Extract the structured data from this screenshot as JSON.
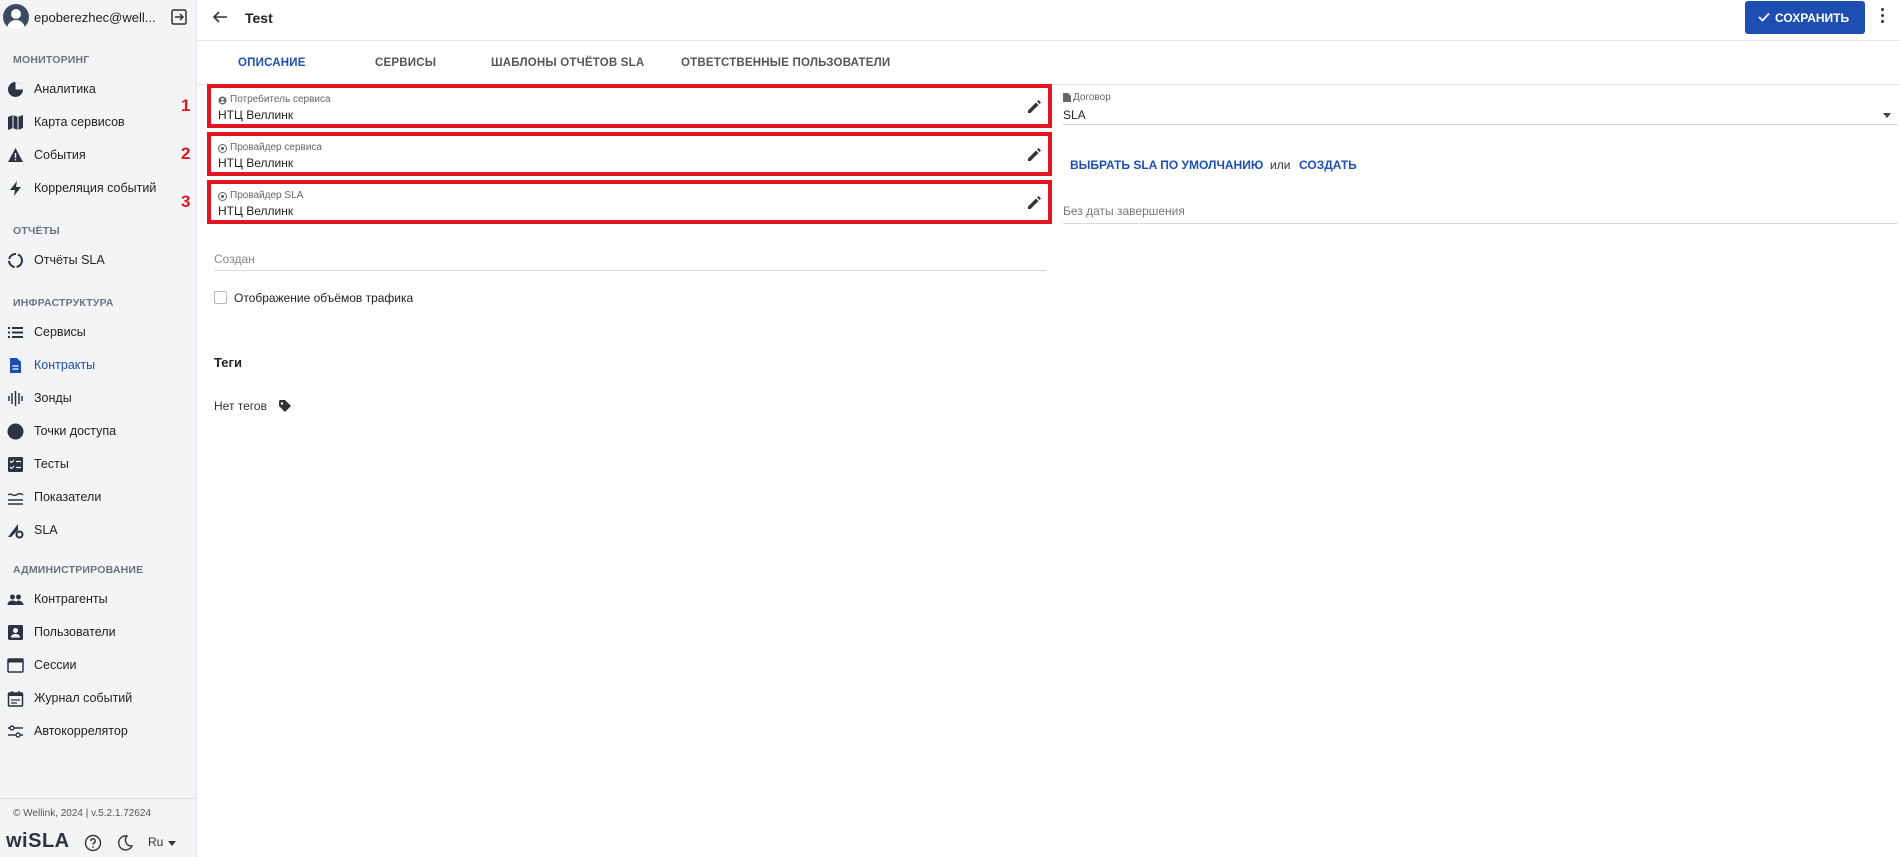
{
  "user": {
    "name": "epoberezhec@well..."
  },
  "sidebar": {
    "sections": [
      {
        "title": "МОНИТОРИНГ",
        "items": [
          {
            "label": "Аналитика",
            "icon": "pie-chart-icon"
          },
          {
            "label": "Карта сервисов",
            "icon": "map-icon"
          },
          {
            "label": "События",
            "icon": "warning-icon"
          },
          {
            "label": "Корреляция событий",
            "icon": "lightning-icon"
          }
        ]
      },
      {
        "title": "ОТЧЁТЫ",
        "items": [
          {
            "label": "Отчёты SLA",
            "icon": "circle-progress-icon"
          }
        ]
      },
      {
        "title": "ИНФРАСТРУКТУРА",
        "items": [
          {
            "label": "Сервисы",
            "icon": "list-icon"
          },
          {
            "label": "Контракты",
            "icon": "document-icon",
            "active": true
          },
          {
            "label": "Зонды",
            "icon": "waveform-icon"
          },
          {
            "label": "Точки доступа",
            "icon": "dot-icon"
          },
          {
            "label": "Тесты",
            "icon": "checklist-icon"
          },
          {
            "label": "Показатели",
            "icon": "lines-icon"
          },
          {
            "label": "SLA",
            "icon": "sla-gear-icon"
          }
        ]
      },
      {
        "title": "АДМИНИСТРИРОВАНИЕ",
        "items": [
          {
            "label": "Контрагенты",
            "icon": "people-icon"
          },
          {
            "label": "Пользователи",
            "icon": "user-card-icon"
          },
          {
            "label": "Сессии",
            "icon": "window-icon"
          },
          {
            "label": "Журнал событий",
            "icon": "calendar-icon"
          },
          {
            "label": "Автокоррелятор",
            "icon": "sliders-icon"
          }
        ]
      }
    ],
    "footer": {
      "copyright": "© Wellink, 2024 | v.5.2.1.72624",
      "logo": "wiSLA",
      "language": "Ru"
    }
  },
  "header": {
    "title": "Test",
    "save_label": "СОХРАНИТЬ"
  },
  "tabs": [
    {
      "label": "ОПИСАНИЕ",
      "active": true
    },
    {
      "label": "СЕРВИСЫ"
    },
    {
      "label": "ШАБЛОНЫ ОТЧЁТОВ SLA"
    },
    {
      "label": "ОТВЕТСТВЕННЫЕ ПОЛЬЗОВАТЕЛИ"
    }
  ],
  "fields": [
    {
      "number": "1",
      "label": "Потребитель сервиса",
      "value": "НТЦ Веллинк"
    },
    {
      "number": "2",
      "label": "Провайдер сервиса",
      "value": "НТЦ Веллинк"
    },
    {
      "number": "3",
      "label": "Провайдер SLA",
      "value": "НТЦ Веллинк"
    }
  ],
  "contract": {
    "label": "Договор",
    "value": "SLA"
  },
  "sla_actions": {
    "default_label": "ВЫБРАТЬ SLA ПО УМОЛЧАНИЮ",
    "or_label": "или",
    "create_label": "СОЗДАТЬ"
  },
  "end_date": "Без даты завершения",
  "created_label": "Создан",
  "traffic_checkbox": {
    "label": "Отображение объёмов трафика",
    "checked": false
  },
  "tags": {
    "title": "Теги",
    "empty_label": "Нет тегов"
  },
  "colors": {
    "accent": "#1d4fb3",
    "highlight": "#e01622",
    "sidebar_bg": "#f3f4f6"
  }
}
